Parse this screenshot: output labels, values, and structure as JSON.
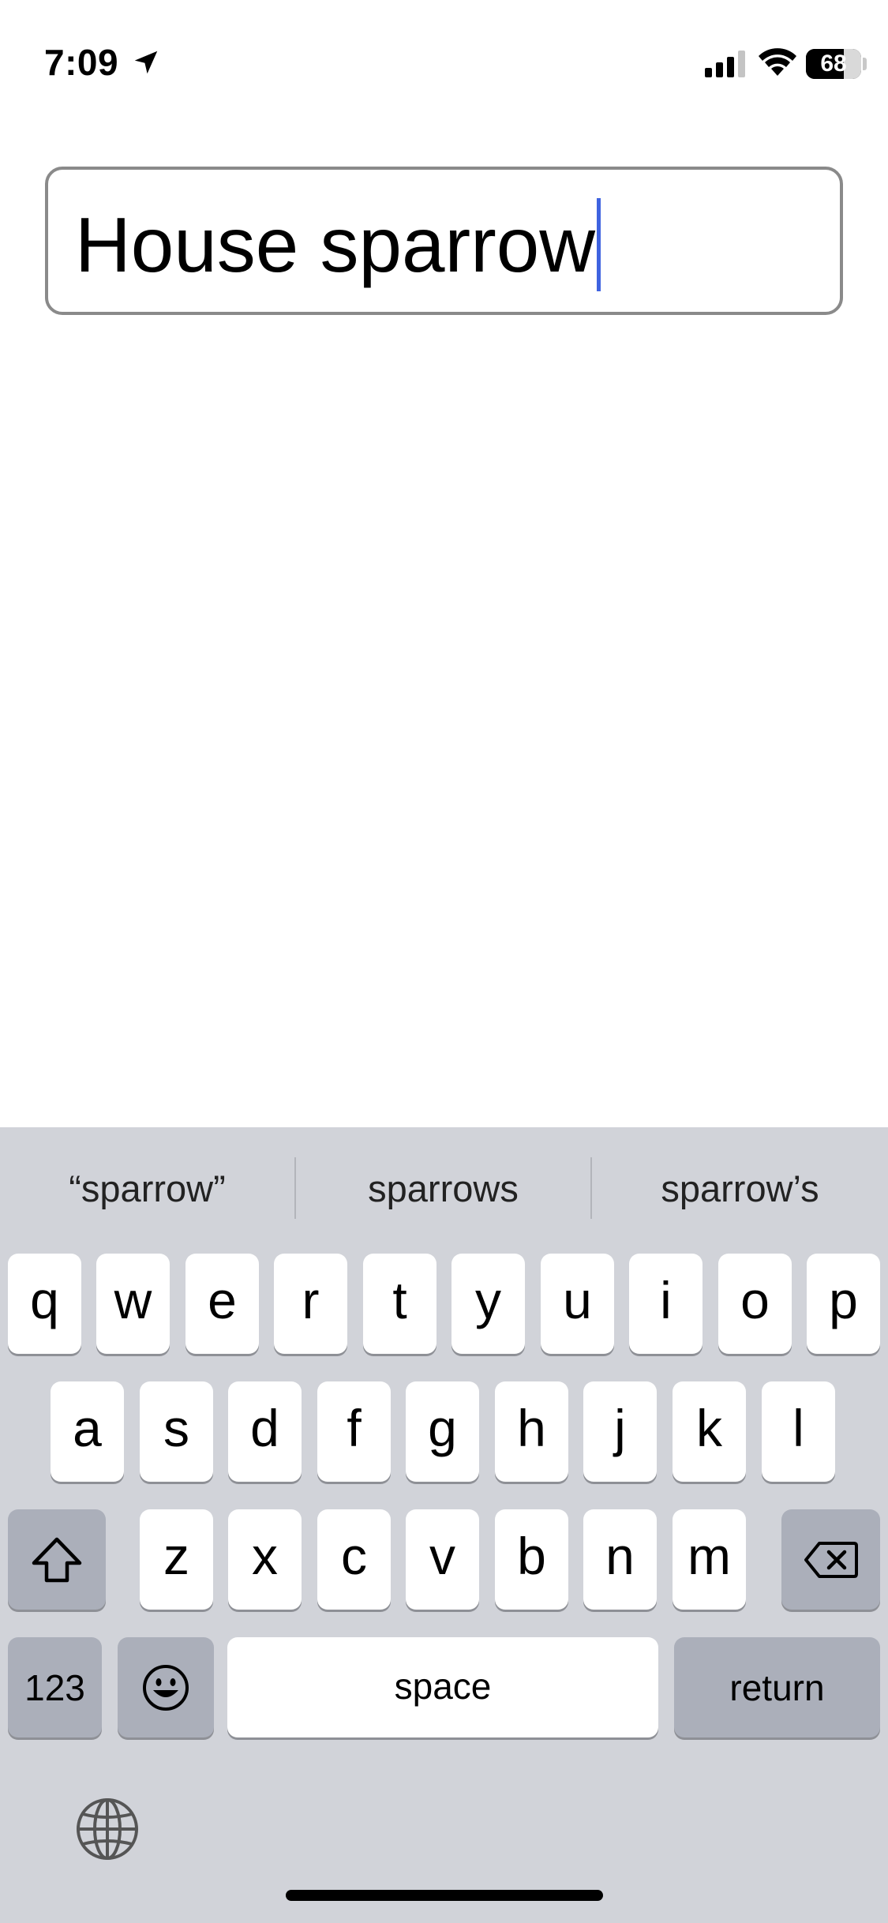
{
  "status_bar": {
    "time": "7:09",
    "battery_percent": "68",
    "battery_level": 0.68,
    "icons": [
      "location-arrow-icon",
      "cellular-signal-icon",
      "wifi-icon",
      "battery-icon"
    ]
  },
  "input": {
    "value": "House sparrow",
    "cursor_color": "#3f63e0"
  },
  "keyboard": {
    "suggestions": [
      "“sparrow”",
      "sparrows",
      "sparrow’s"
    ],
    "row1": [
      "q",
      "w",
      "e",
      "r",
      "t",
      "y",
      "u",
      "i",
      "o",
      "p"
    ],
    "row2": [
      "a",
      "s",
      "d",
      "f",
      "g",
      "h",
      "j",
      "k",
      "l"
    ],
    "row3": [
      "z",
      "x",
      "c",
      "v",
      "b",
      "n",
      "m"
    ],
    "numbers_label": "123",
    "space_label": "space",
    "return_label": "return",
    "icons": [
      "shift-icon",
      "delete-icon",
      "emoji-icon",
      "globe-icon"
    ]
  },
  "colors": {
    "keyboard_background": "#d1d3d9",
    "function_key": "#abafba",
    "text_field_border": "#8a8a8a"
  }
}
